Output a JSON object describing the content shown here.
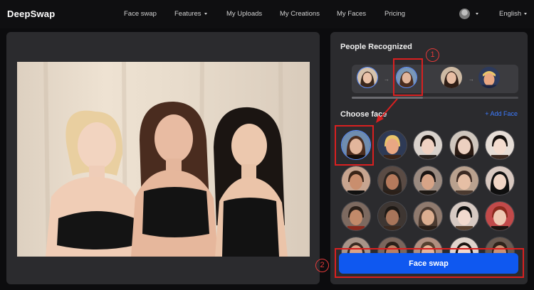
{
  "app": {
    "logo": "DeepSwap"
  },
  "nav": {
    "items": [
      {
        "label": "Face swap"
      },
      {
        "label": "Features",
        "has_dropdown": true
      },
      {
        "label": "My Uploads"
      },
      {
        "label": "My Creations"
      },
      {
        "label": "My Faces"
      },
      {
        "label": "Pricing"
      }
    ],
    "language": "English"
  },
  "people": {
    "title": "People Recognized",
    "pairs": [
      {
        "from": "woman-portrait",
        "to": "woman-portrait",
        "selected": true
      },
      {
        "from": "woman-portrait",
        "to": "man-portrait",
        "selected": false
      }
    ]
  },
  "choose_face": {
    "title": "Choose face",
    "add_label": "+ Add Face",
    "selected_index": 0,
    "rows": 4,
    "columns": 5
  },
  "actions": {
    "swap_label": "Face swap"
  },
  "annotations": {
    "marker_1": "1",
    "marker_2": "2"
  },
  "colors": {
    "accent": "#0f58f0",
    "link": "#3d7bff",
    "highlight": "#d92020",
    "panel": "#2b2b2e",
    "background": "#0c0c0e"
  }
}
